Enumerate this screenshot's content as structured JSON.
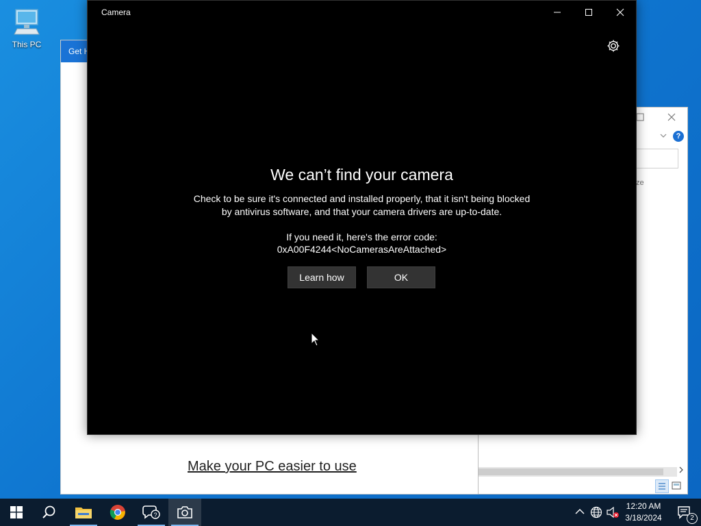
{
  "desktop": {
    "icon_label": "This PC"
  },
  "help_window": {
    "tab_label": "Get H",
    "link_text": "Make your PC easier to use"
  },
  "explorer_window": {
    "column_fragment": "ze"
  },
  "camera": {
    "title": "Camera",
    "heading": "We can’t find your camera",
    "message_line1": "Check to be sure it's connected and installed properly, that it isn't being blocked",
    "message_line2": "by antivirus software, and that your camera drivers are up-to-date.",
    "error_intro": "If you need it, here's the error code:",
    "error_code": "0xA00F4244<NoCamerasAreAttached>",
    "learn_button": "Learn how",
    "ok_button": "OK"
  },
  "taskbar": {
    "time": "12:20 AM",
    "date": "3/18/2024",
    "notification_count": "2",
    "pinned": [
      "start-icon",
      "search-icon",
      "file-explorer-icon",
      "chrome-icon",
      "feedback-hub-icon",
      "camera-icon"
    ],
    "active_app": "camera"
  },
  "colors": {
    "taskbar": "#0b1c2f",
    "accent": "#1a73d6",
    "camera_bg": "#000000",
    "button_bg": "#333333"
  }
}
